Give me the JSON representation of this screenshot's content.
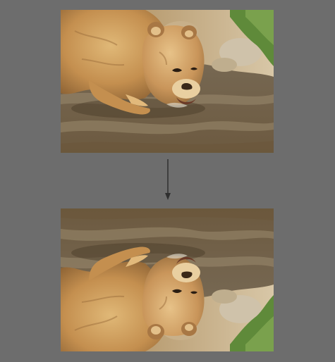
{
  "scene": {
    "top_image": {
      "subject": "lion-cub-drinking-from-stream",
      "orientation": "original"
    },
    "connector": {
      "icon": "down-arrow-icon"
    },
    "bottom_image": {
      "subject": "lion-cub-drinking-from-stream",
      "orientation": "flipped-vertical"
    }
  },
  "colors": {
    "background": "#6d6d6d",
    "arrow": "#2f2f2f",
    "water": "#7e6e56",
    "fur": "#c89a5a",
    "grass": "#5f8a3a"
  }
}
